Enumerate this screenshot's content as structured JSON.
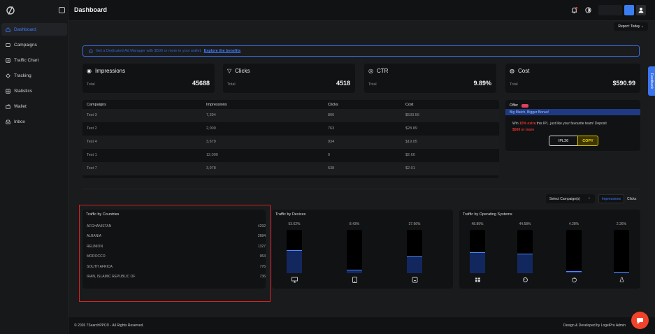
{
  "topbar": {
    "title": "Dashboard"
  },
  "sidebar": {
    "items": [
      {
        "label": "Dashboard",
        "icon": "home-icon"
      },
      {
        "label": "Campaigns",
        "icon": "campaign-icon"
      },
      {
        "label": "Traffic Chart",
        "icon": "chart-icon"
      },
      {
        "label": "Tracking",
        "icon": "tracking-icon"
      },
      {
        "label": "Statistics",
        "icon": "statistics-icon"
      },
      {
        "label": "Wallet",
        "icon": "wallet-icon"
      },
      {
        "label": "Inbox",
        "icon": "inbox-icon"
      }
    ]
  },
  "report": {
    "label": "Report: Today"
  },
  "banner": {
    "text": "Get a Dedicated Ad Manager with $500 or more in your wallet.",
    "link": "Explore the benefits"
  },
  "cards": [
    {
      "label": "Impressions",
      "sub": "Total",
      "value": "45688",
      "icon": "eye-icon"
    },
    {
      "label": "Clicks",
      "sub": "Total",
      "value": "4518",
      "icon": "click-icon"
    },
    {
      "label": "CTR",
      "sub": "Total",
      "value": "9.89%",
      "icon": "ctr-icon"
    },
    {
      "label": "Cost",
      "sub": "Total",
      "value": "$590.99",
      "icon": "cost-icon"
    }
  ],
  "campaign_table": {
    "headers": [
      "Campaigns",
      "Impressions",
      "Clicks",
      "Cost"
    ],
    "rows": [
      [
        "Test 3",
        "7,394",
        "800",
        "$533.56"
      ],
      [
        "Test 2",
        "2,000",
        "763",
        "$28.89"
      ],
      [
        "Test 4",
        "3,679",
        "934",
        "$19.05"
      ],
      [
        "Test 1",
        "12,000",
        "0",
        "$2.60"
      ],
      [
        "Test 7",
        "3,978",
        "538",
        "$2.01"
      ]
    ]
  },
  "offer": {
    "title": "Offer",
    "bar_text": "Big Match, Bigger Bonus!",
    "text_a": "Win",
    "highlight": "10% extra",
    "text_b": "this IPL, just like your favourite team! Deposit",
    "amount": "$500 or more",
    "code": "IPL26",
    "copy_label": "COPY"
  },
  "filters": {
    "select_label": "Select Campaign(s)",
    "toggle_impressions": "Impressions",
    "toggle_clicks": "Clicks"
  },
  "countries": {
    "title": "Traffic by Countries",
    "rows": [
      [
        "AFGHANISTAN",
        "4292"
      ],
      [
        "ALBANIA",
        "2684"
      ],
      [
        "REUNION",
        "1327"
      ],
      [
        "MOROCCO",
        "953"
      ],
      [
        "SOUTH AFRICA",
        "776"
      ],
      [
        "IRAN, ISLAMIC REPUBLIC OF",
        "736"
      ]
    ]
  },
  "devices": {
    "title": "Traffic by Devices",
    "items": [
      {
        "pct": "53.62%",
        "value": 53.62,
        "icon": "desktop-icon"
      },
      {
        "pct": "8.43%",
        "value": 8.43,
        "icon": "tablet-icon"
      },
      {
        "pct": "37.96%",
        "value": 37.96,
        "icon": "mobile-icon"
      }
    ]
  },
  "os": {
    "title": "Traffic by Operating Systems",
    "items": [
      {
        "pct": "48.89%",
        "value": 48.89,
        "icon": "windows-icon"
      },
      {
        "pct": "44.58%",
        "value": 44.58,
        "icon": "android-icon"
      },
      {
        "pct": "4.28%",
        "value": 4.28,
        "icon": "apple-icon"
      },
      {
        "pct": "2.26%",
        "value": 2.26,
        "icon": "linux-icon"
      }
    ]
  },
  "footer": {
    "left": "© 2026 7SearchPPC® - All Rights Reserved.",
    "right": "Design & Developed by LogelPro Admin"
  },
  "feedback": "Feedback",
  "colors": {
    "accent": "#3d7cff",
    "highlight": "#d72222",
    "offer_code": "#f1d500"
  }
}
